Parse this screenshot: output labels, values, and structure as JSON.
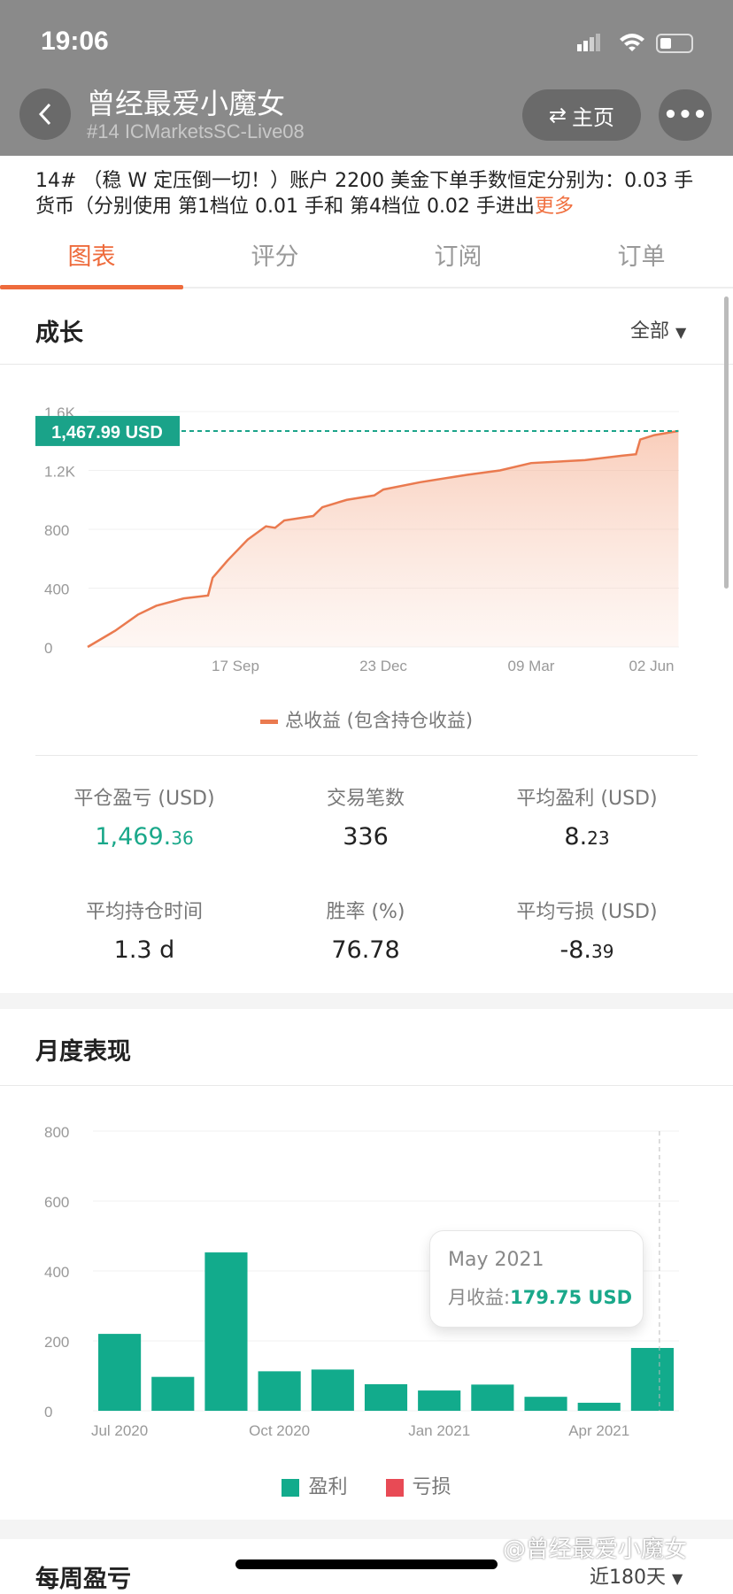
{
  "status": {
    "time": "19:06"
  },
  "header": {
    "title": "曾经最爱小魔女",
    "subtitle": "#14 ICMarketsSC-Live08",
    "home_label": "主页",
    "more_label": "•••"
  },
  "description": {
    "text": "14# （稳 W 定压倒一切！）账户 2200 美金下单手数恒定分别为：0.03 手货币（分别使用 第1档位 0.01 手和 第4档位 0.02 手进出",
    "more_label": "更多"
  },
  "tabs": [
    {
      "label": "图表",
      "active": true
    },
    {
      "label": "评分"
    },
    {
      "label": "订阅"
    },
    {
      "label": "订单"
    }
  ],
  "growth": {
    "title": "成长",
    "range": "全部",
    "badge": "1,467.99 USD",
    "legend": "总收益 (包含持仓收益)"
  },
  "stats": [
    {
      "label": "平仓盈亏 (USD)",
      "int": "1,469.",
      "dec": "36",
      "green": true
    },
    {
      "label": "交易笔数",
      "int": "336",
      "dec": ""
    },
    {
      "label": "平均盈利 (USD)",
      "int": "8.",
      "dec": "23"
    },
    {
      "label": "平均持仓时间",
      "int": "1.3 d",
      "dec": ""
    },
    {
      "label": "胜率 (%)",
      "int": "76.78",
      "dec": ""
    },
    {
      "label": "平均亏损 (USD)",
      "int": "-8.",
      "dec": "39"
    }
  ],
  "monthly": {
    "title": "月度表现",
    "tooltip_month": "May 2021",
    "tooltip_label": "月收益:",
    "tooltip_value": "179.75 USD",
    "legend": [
      "盈利",
      "亏损"
    ]
  },
  "weekly": {
    "title": "每周盈亏",
    "range": "近180天"
  },
  "watermark": "@曾经最爱小魔女",
  "colors": {
    "accent": "#ee6b3c",
    "profit": "#12ab8c",
    "loss": "#e84a55",
    "line": "#ea7a4f"
  },
  "chart_data": [
    {
      "type": "area",
      "ylim": [
        0,
        1600
      ],
      "yticks": [
        "0",
        "400",
        "800",
        "1.2K",
        "1.6K"
      ],
      "xticks": [
        "17 Sep",
        "23 Dec",
        "09 Mar",
        "02 Jun"
      ],
      "xtick_dates": [
        "2020-09-17",
        "2020-12-23",
        "2021-03-09",
        "2021-06-02"
      ],
      "series": [
        {
          "name": "总收益 (包含持仓收益)",
          "points": [
            [
              "2020-06-12",
              0
            ],
            [
              "2020-06-30",
              110
            ],
            [
              "2020-07-15",
              220
            ],
            [
              "2020-07-27",
              280
            ],
            [
              "2020-08-14",
              330
            ],
            [
              "2020-08-30",
              350
            ],
            [
              "2020-09-02",
              470
            ],
            [
              "2020-09-12",
              590
            ],
            [
              "2020-09-25",
              730
            ],
            [
              "2020-10-07",
              820
            ],
            [
              "2020-10-13",
              810
            ],
            [
              "2020-10-19",
              860
            ],
            [
              "2020-11-07",
              890
            ],
            [
              "2020-11-13",
              950
            ],
            [
              "2020-11-29",
              1000
            ],
            [
              "2020-12-17",
              1030
            ],
            [
              "2020-12-23",
              1070
            ],
            [
              "2021-01-11",
              1120
            ],
            [
              "2021-02-04",
              1170
            ],
            [
              "2021-02-21",
              1200
            ],
            [
              "2021-03-09",
              1250
            ],
            [
              "2021-04-16",
              1270
            ],
            [
              "2021-05-12",
              1300
            ],
            [
              "2021-05-22",
              1310
            ],
            [
              "2021-05-25",
              1410
            ],
            [
              "2021-06-04",
              1440
            ],
            [
              "2021-06-21",
              1467.99
            ]
          ]
        }
      ]
    },
    {
      "type": "bar",
      "ylim": [
        0,
        800
      ],
      "yticks": [
        "0",
        "200",
        "400",
        "600",
        "800"
      ],
      "categories": [
        "Jul 2020",
        "Aug 2020",
        "Sep 2020",
        "Oct 2020",
        "Nov 2020",
        "Dec 2020",
        "Jan 2021",
        "Feb 2021",
        "Mar 2021",
        "Apr 2021",
        "May 2021"
      ],
      "xtick_labels": [
        "Jul 2020",
        "Oct 2020",
        "Jan 2021",
        "Apr 2021"
      ],
      "values": [
        220,
        97,
        453,
        113,
        118,
        76,
        58,
        75,
        40,
        23,
        179.75
      ],
      "highlight": "May 2021"
    }
  ]
}
